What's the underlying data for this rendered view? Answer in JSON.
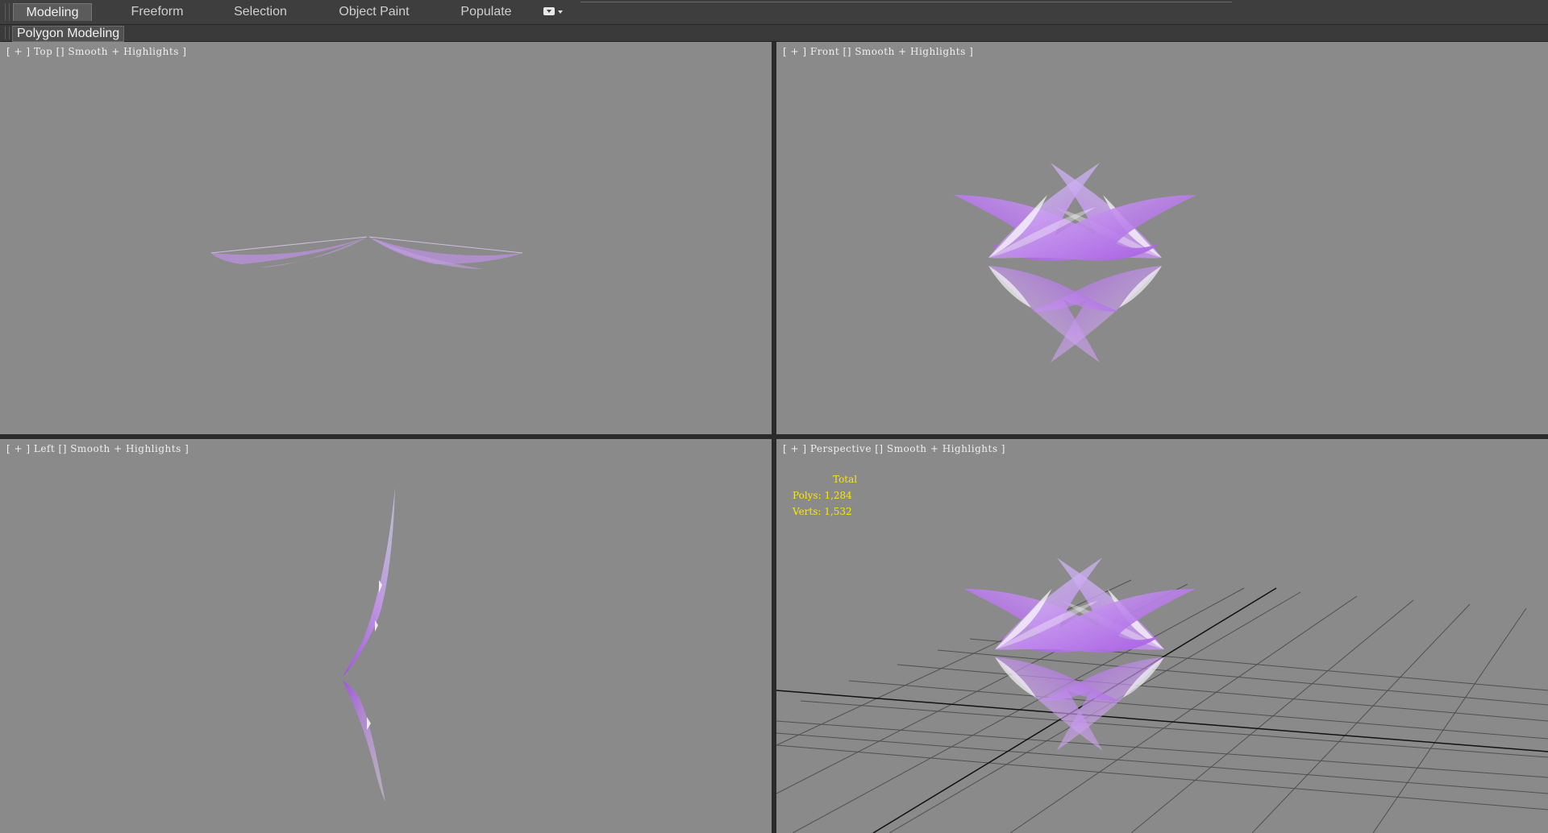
{
  "ribbon": {
    "tabs": [
      {
        "label": "Modeling",
        "active": true
      },
      {
        "label": "Freeform",
        "active": false
      },
      {
        "label": "Selection",
        "active": false
      },
      {
        "label": "Object Paint",
        "active": false
      },
      {
        "label": "Populate",
        "active": false
      }
    ],
    "panel_label": "Polygon Modeling"
  },
  "viewports": {
    "top": {
      "label": "[ + ] Top [] Smooth + Highlights ]"
    },
    "front": {
      "label": "[ + ] Front [] Smooth + Highlights ]"
    },
    "left": {
      "label": "[ + ] Left [] Smooth + Highlights ]"
    },
    "perspective": {
      "label": "[ + ] Perspective [] Smooth + Highlights ]",
      "stats": {
        "title": "Total",
        "polys": "Polys: 1,284",
        "verts": "Verts: 1,532"
      }
    }
  },
  "colors": {
    "viewport_bg": "#8a8a8a",
    "stats_text": "#ffe600",
    "wing_purple": "#b070e0",
    "wing_blue": "#b8c8f0"
  }
}
